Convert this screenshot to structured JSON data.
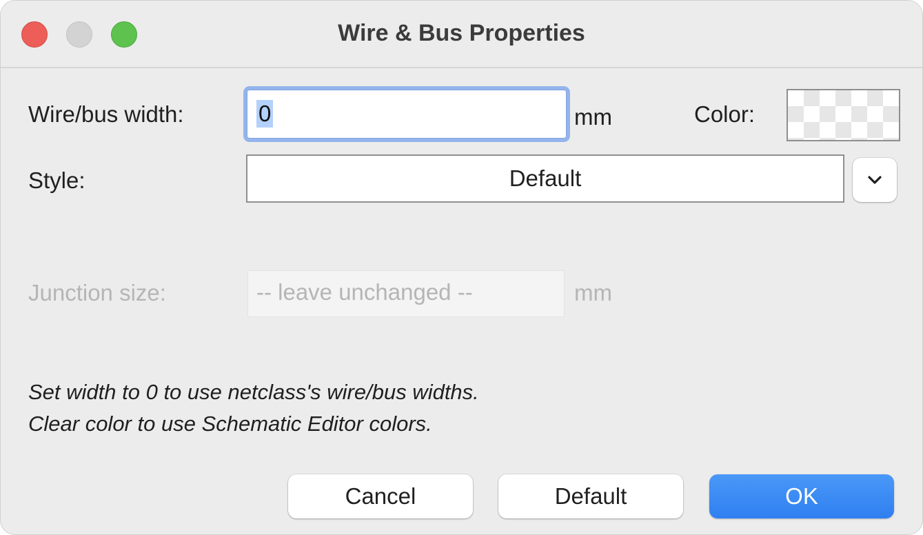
{
  "window": {
    "title": "Wire & Bus Properties"
  },
  "form": {
    "width_label": "Wire/bus width:",
    "width_value": "0",
    "width_unit": "mm",
    "color_label": "Color:",
    "style_label": "Style:",
    "style_value": "Default",
    "junction_label": "Junction size:",
    "junction_placeholder": "-- leave unchanged --",
    "junction_unit": "mm"
  },
  "hints": [
    "Set width to 0 to use netclass's wire/bus widths.",
    "Clear color to use Schematic Editor colors."
  ],
  "buttons": {
    "cancel": "Cancel",
    "default": "Default",
    "ok": "OK"
  },
  "colors": {
    "accent": "#2f7ff1",
    "focus_ring": "#93b4ec",
    "close": "#ec5e57",
    "minimize": "#d3d3d3",
    "zoom": "#5dc34e"
  },
  "icons": {
    "style_dropdown": "chevron-down-icon",
    "color_swatch": "transparency-checkerboard"
  }
}
